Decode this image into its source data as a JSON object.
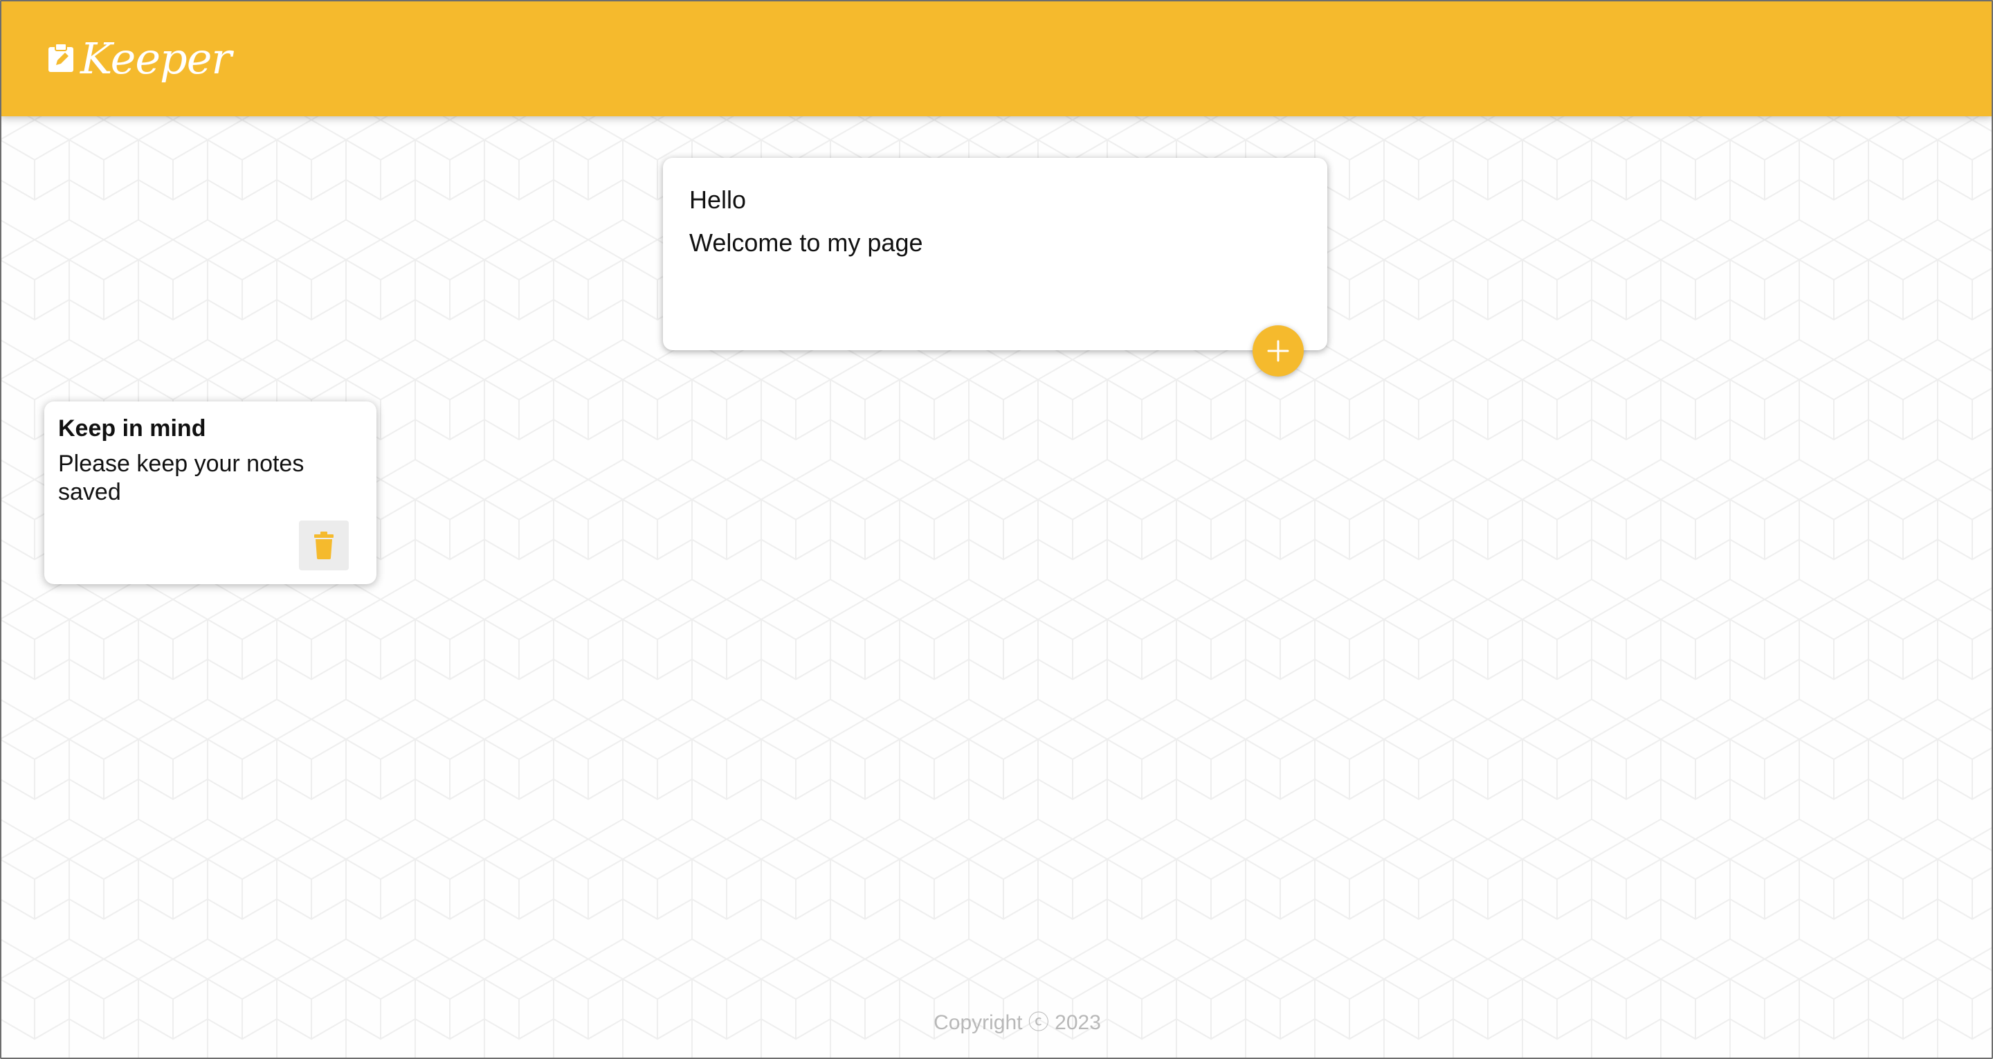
{
  "app": {
    "title": "Keeper"
  },
  "create_note": {
    "title_value": "Hello",
    "content_value": "Welcome to my page",
    "add_button_icon": "plus-icon"
  },
  "notes": [
    {
      "title": "Keep in mind",
      "content": "Please keep your notes saved",
      "delete_icon": "trash-icon"
    }
  ],
  "footer": {
    "text": "Copyright ⓒ 2023"
  },
  "colors": {
    "brand": "#f5ba2d",
    "card": "#ffffff",
    "delete_bg": "#ececec",
    "footer_text": "#b8b8b8"
  }
}
